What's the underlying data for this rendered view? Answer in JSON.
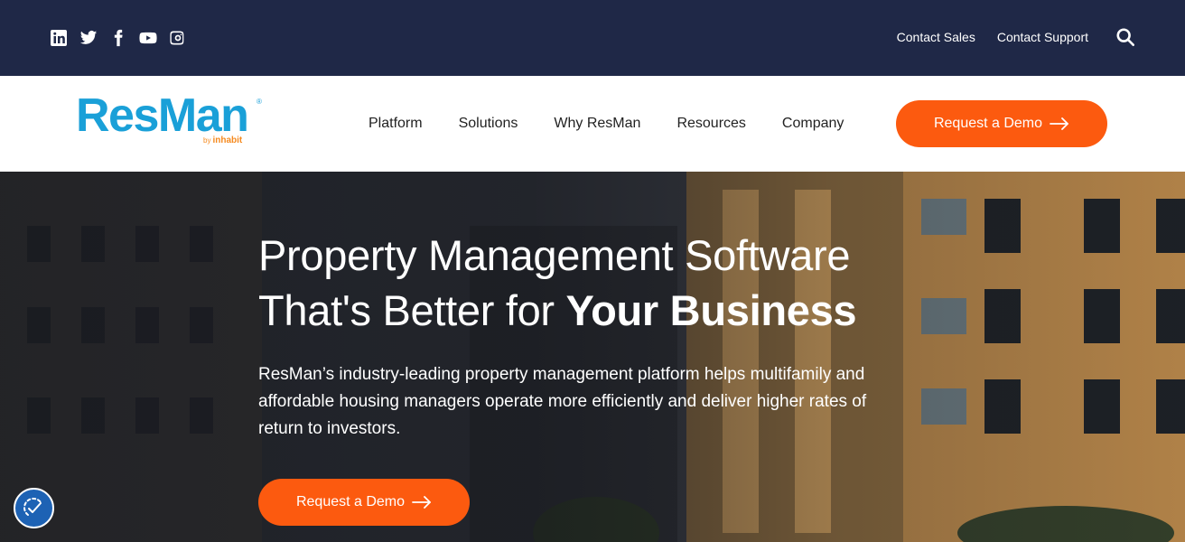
{
  "topbar": {
    "social_icons": [
      "linkedin-icon",
      "twitter-icon",
      "facebook-icon",
      "youtube-icon",
      "instagram-icon"
    ],
    "links": [
      "Contact Sales",
      "Contact Support"
    ],
    "search_icon": "search-icon"
  },
  "nav": {
    "logo": {
      "text": "ResMan",
      "registered": "®",
      "by": "by",
      "sub": "inhabit"
    },
    "items": [
      "Platform",
      "Solutions",
      "Why ResMan",
      "Resources",
      "Company"
    ],
    "cta": "Request a Demo"
  },
  "hero": {
    "title_line1": "Property Management Software",
    "title_line2_prefix": "That's Better for ",
    "title_line2_bold": "Your Business",
    "body": "ResMan’s industry-leading property management platform helps multifamily and affordable housing managers operate more efficiently and deliver higher rates of return to investors.",
    "cta": "Request a Demo"
  },
  "accessibility_widget": {
    "icon": "accessibility-icon"
  },
  "colors": {
    "topbar_bg": "#1f2847",
    "brand_blue": "#1aa0d8",
    "brand_orange": "#f58a1f",
    "cta_orange": "#fc5a0f"
  }
}
